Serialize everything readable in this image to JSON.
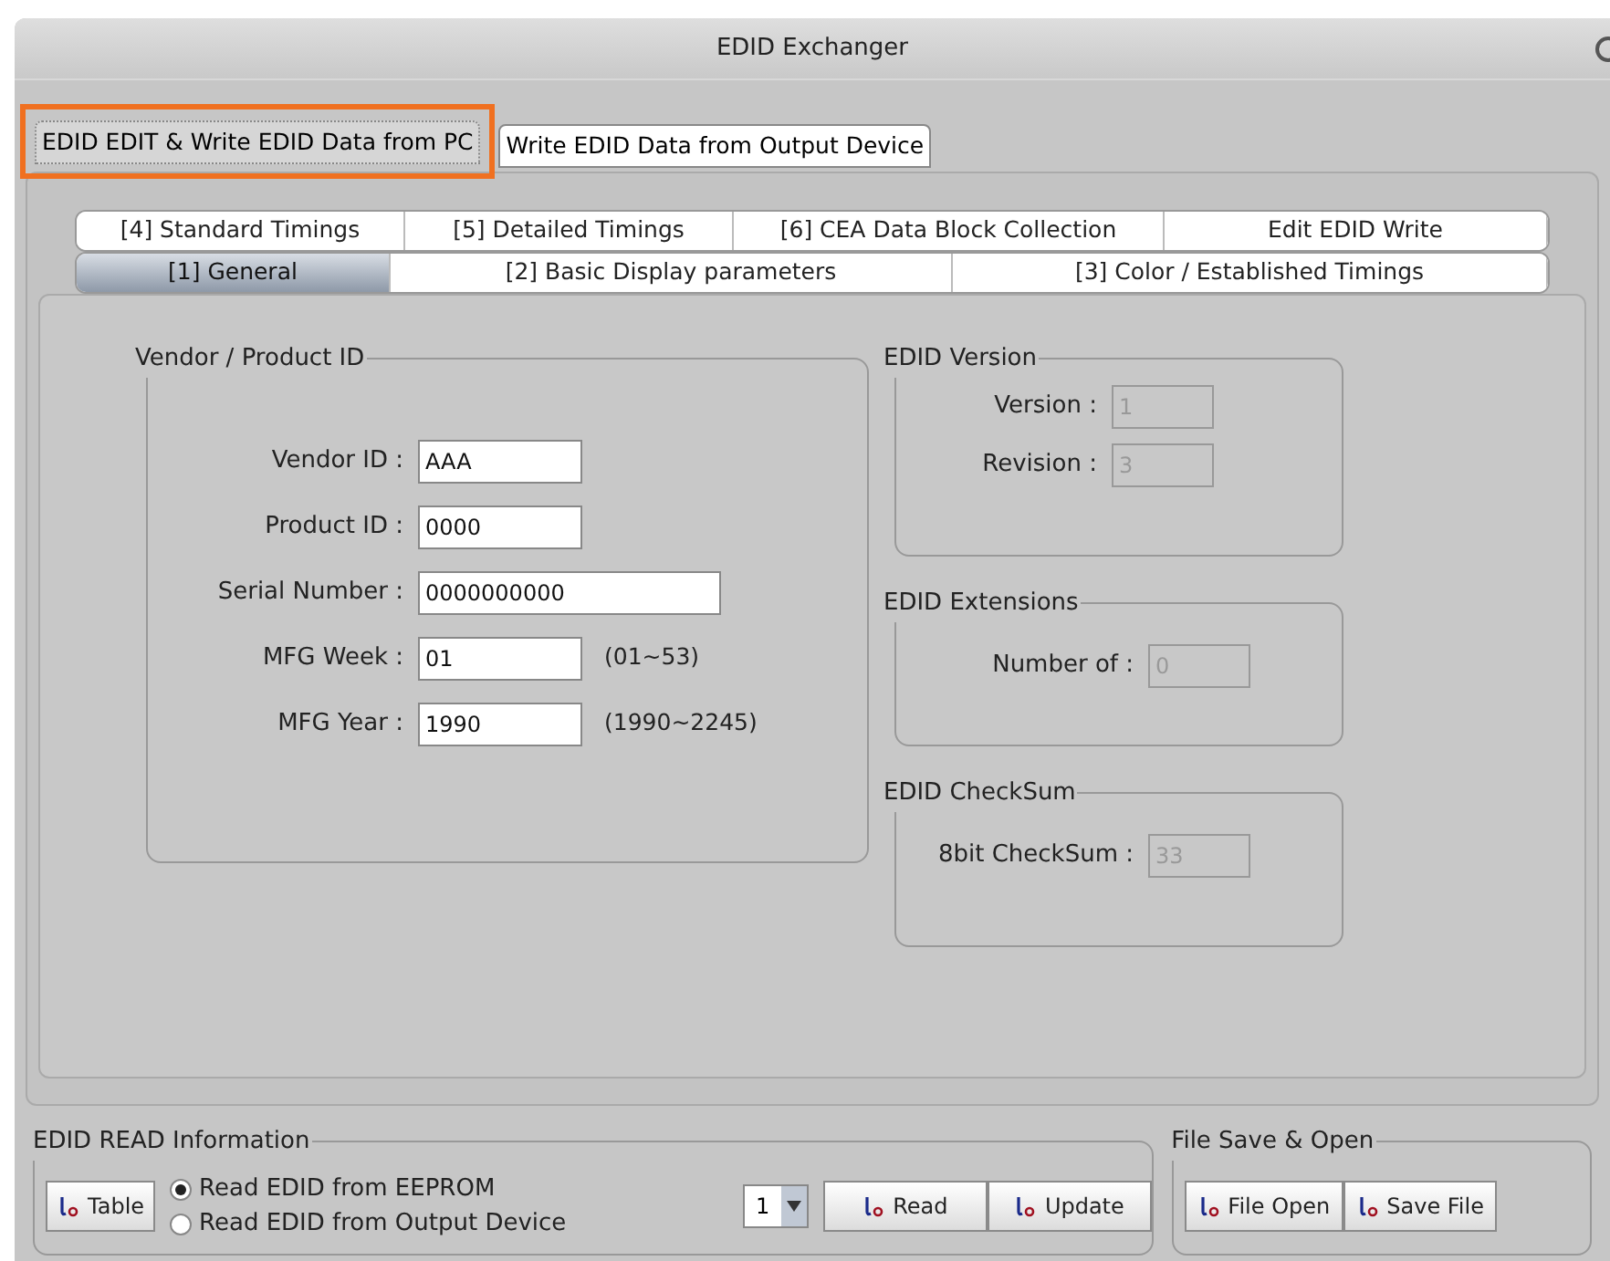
{
  "window": {
    "title": "EDID Exchanger"
  },
  "outer_tabs": [
    {
      "label": "EDID EDIT & Write EDID Data from PC",
      "selected": true,
      "highlighted": true
    },
    {
      "label": "Write EDID Data from Output Device",
      "selected": false,
      "highlighted": false
    }
  ],
  "inner_tabs_top": [
    {
      "label": "[4] Standard Timings",
      "selected": false
    },
    {
      "label": "[5] Detailed Timings",
      "selected": false
    },
    {
      "label": "[6] CEA Data Block Collection",
      "selected": false
    },
    {
      "label": "Edit EDID Write",
      "selected": false
    }
  ],
  "inner_tabs_bottom": [
    {
      "label": "[1] General",
      "selected": true
    },
    {
      "label": "[2] Basic Display parameters",
      "selected": false
    },
    {
      "label": "[3] Color / Established Timings",
      "selected": false
    }
  ],
  "vendor_product": {
    "title": "Vendor / Product ID",
    "fields": [
      {
        "label": "Vendor ID :",
        "value": "AAA"
      },
      {
        "label": "Product ID :",
        "value": "0000"
      },
      {
        "label": "Serial Number :",
        "value": "0000000000",
        "wide": true
      },
      {
        "label": "MFG Week :",
        "value": "01",
        "range": "(01~53)"
      },
      {
        "label": "MFG Year :",
        "value": "1990",
        "range": "(1990~2245)"
      }
    ]
  },
  "right_groups": [
    {
      "title": "EDID Version",
      "fields": [
        {
          "label": "Version :",
          "value": "1",
          "disabled": true
        },
        {
          "label": "Revision :",
          "value": "3",
          "disabled": true
        }
      ]
    },
    {
      "title": "EDID Extensions",
      "fields": [
        {
          "label": "Number of :",
          "value": "0",
          "disabled": true
        }
      ]
    },
    {
      "title": "EDID CheckSum",
      "fields": [
        {
          "label": "8bit CheckSum :",
          "value": "33",
          "disabled": true
        }
      ]
    }
  ],
  "read_info": {
    "title": "EDID READ Information",
    "table_button": "Table",
    "radios": [
      {
        "label": "Read EDID from EEPROM",
        "selected": true
      },
      {
        "label": "Read EDID from Output Device",
        "selected": false
      }
    ],
    "dropdown": "1",
    "buttons": [
      "Read",
      "Update"
    ]
  },
  "file_group": {
    "title": "File Save & Open",
    "buttons": [
      "File Open",
      "Save File"
    ]
  }
}
